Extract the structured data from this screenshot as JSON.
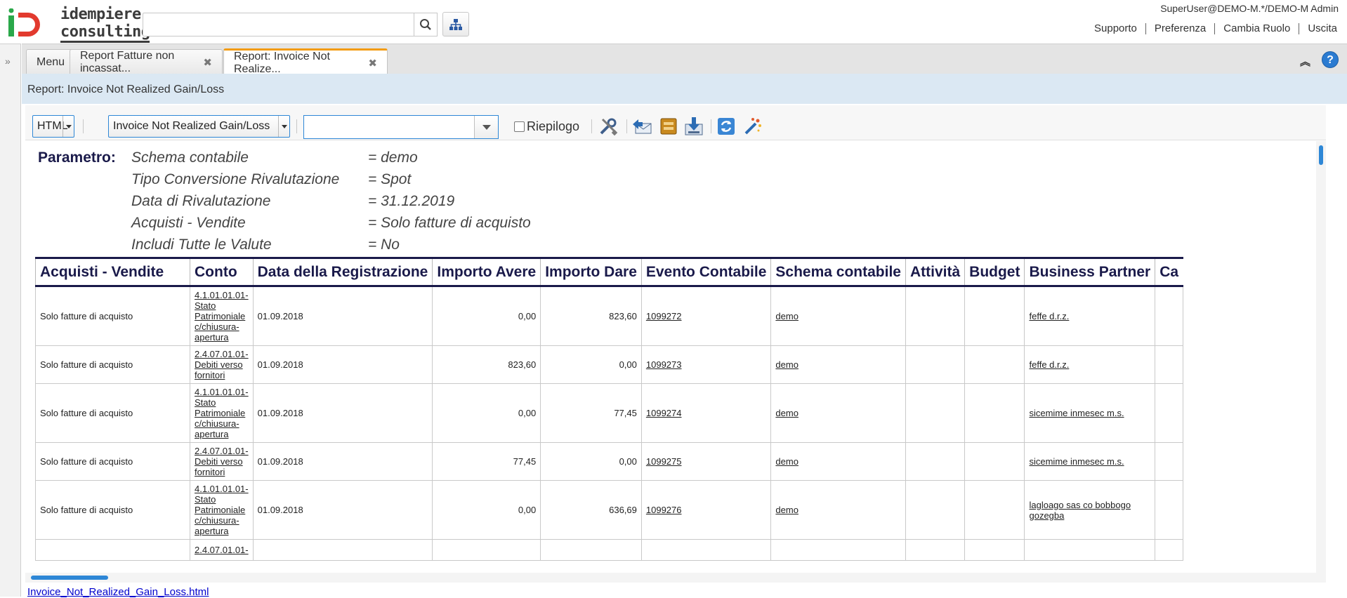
{
  "header": {
    "brand_line1": "idempiere",
    "brand_line2": "consulting",
    "search_placeholder": "",
    "user": "SuperUser@DEMO-M.*/DEMO-M Admin",
    "links": [
      "Supporto",
      "Preferenza",
      "Cambia Ruolo",
      "Uscita"
    ]
  },
  "tabs": [
    {
      "label": "Menu",
      "closable": false,
      "active": false
    },
    {
      "label": "Report Fatture non incassat...",
      "closable": true,
      "active": false
    },
    {
      "label": "Report: Invoice Not Realize...",
      "closable": true,
      "active": true
    }
  ],
  "page_title": "Report: Invoice Not Realized Gain/Loss",
  "toolbar": {
    "format": "HTML",
    "report_view": "Invoice Not Realized Gain/Loss",
    "print_format_value": "",
    "summary_label": "Riepilogo",
    "summary_checked": false
  },
  "params": {
    "heading": "Parametro:",
    "rows": [
      {
        "name": "Schema contabile",
        "value": "= demo"
      },
      {
        "name": "Tipo Conversione Rivalutazione",
        "value": "= Spot"
      },
      {
        "name": "Data di Rivalutazione",
        "value": "= 31.12.2019"
      },
      {
        "name": "Acquisti - Vendite",
        "value": "= Solo fatture di acquisto"
      },
      {
        "name": "Includi Tutte le Valute",
        "value": "= No"
      }
    ]
  },
  "table": {
    "columns": [
      "Acquisti - Vendite",
      "Conto",
      "Data della Registrazione",
      "Importo Avere",
      "Importo Dare",
      "Evento Contabile",
      "Schema contabile",
      "Attività",
      "Budget",
      "Business Partner",
      "Ca"
    ],
    "rows": [
      {
        "tipo": "Solo fatture di acquisto",
        "conto": "4.1.01.01.01-Stato Patrimoniale c/chiusura-apertura",
        "data": "01.09.2018",
        "avere": "0,00",
        "dare": "823,60",
        "evento": "1099272",
        "schema": "demo",
        "attivita": "",
        "budget": "",
        "bp": "feffe d.r.z."
      },
      {
        "tipo": "Solo fatture di acquisto",
        "conto": "2.4.07.01.01-Debiti verso fornitori",
        "data": "01.09.2018",
        "avere": "823,60",
        "dare": "0,00",
        "evento": "1099273",
        "schema": "demo",
        "attivita": "",
        "budget": "",
        "bp": "feffe d.r.z."
      },
      {
        "tipo": "Solo fatture di acquisto",
        "conto": "4.1.01.01.01-Stato Patrimoniale c/chiusura-apertura",
        "data": "01.09.2018",
        "avere": "0,00",
        "dare": "77,45",
        "evento": "1099274",
        "schema": "demo",
        "attivita": "",
        "budget": "",
        "bp": "sicemime inmesec m.s."
      },
      {
        "tipo": "Solo fatture di acquisto",
        "conto": "2.4.07.01.01-Debiti verso fornitori",
        "data": "01.09.2018",
        "avere": "77,45",
        "dare": "0,00",
        "evento": "1099275",
        "schema": "demo",
        "attivita": "",
        "budget": "",
        "bp": "sicemime inmesec m.s."
      },
      {
        "tipo": "Solo fatture di acquisto",
        "conto": "4.1.01.01.01-Stato Patrimoniale c/chiusura-apertura",
        "data": "01.09.2018",
        "avere": "0,00",
        "dare": "636,69",
        "evento": "1099276",
        "schema": "demo",
        "attivita": "",
        "budget": "",
        "bp": "lagloago sas co bobbogo gozegba"
      },
      {
        "tipo": "",
        "conto": "2.4.07.01.01-",
        "data": "",
        "avere": "",
        "dare": "",
        "evento": "",
        "schema": "",
        "attivita": "",
        "budget": "",
        "bp": ""
      }
    ]
  },
  "footer_link": "Invoice_Not_Realized_Gain_Loss.html",
  "colors": {
    "accent": "#2e87d6",
    "tab_active": "#f39c12",
    "titlebar": "#dbe8f3",
    "heading": "#1a1a4a"
  }
}
